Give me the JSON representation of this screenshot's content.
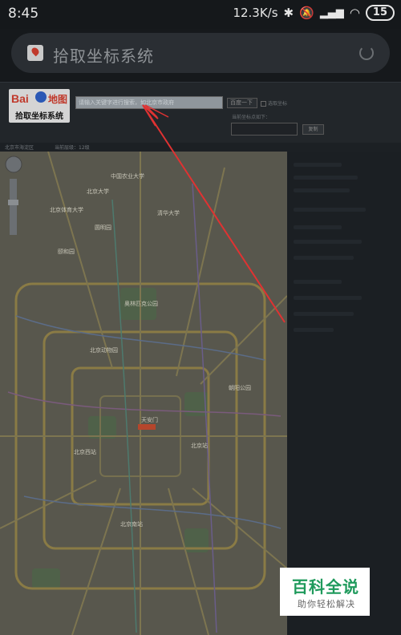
{
  "status_bar": {
    "time": "8:45",
    "network_speed": "12.3K/s",
    "battery": "15",
    "icons": [
      "bluetooth-icon",
      "mute-icon",
      "signal-icon",
      "wifi-icon",
      "battery-icon"
    ]
  },
  "browser": {
    "page_title": "拾取坐标系统",
    "favicon": "map-pin-icon",
    "reload_icon": "reload-icon"
  },
  "page": {
    "logo": {
      "bai_text": "Bai",
      "map_text": "地图",
      "subtitle": "拾取坐标系统"
    },
    "search_placeholder": "请输入关键字进行搜索，如北京市政府",
    "city_select": "百度一下",
    "checkbox_label": "选取坐标",
    "coord_label": "当前坐标点如下：",
    "copy_button": "复制",
    "info_city": "北京市海淀区",
    "info_level": "当前层级：12级"
  },
  "map_labels": [
    "中国农业大学",
    "北京大学",
    "北京体育大学",
    "清华大学",
    "圆明园",
    "颐和园",
    "奥林匹克公园",
    "北京动物园",
    "天安门",
    "北京站",
    "北京西站",
    "北京南站",
    "朝阳公园"
  ],
  "watermark": {
    "title": "百科全说",
    "subtitle": "助你轻松解决"
  },
  "colors": {
    "arrow": "#e03232",
    "map_bg": "#5b5a50",
    "watermark_green": "#1f9a5c"
  }
}
